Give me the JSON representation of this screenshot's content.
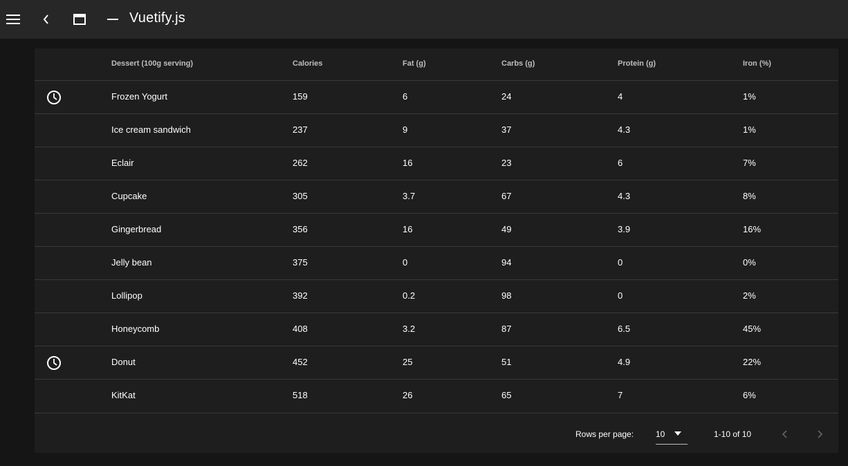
{
  "toolbar": {
    "title": "Vuetify.js",
    "icons": [
      "menu-icon",
      "back-icon",
      "window-icon",
      "minimize-icon"
    ]
  },
  "table": {
    "headers": [
      "Dessert (100g serving)",
      "Calories",
      "Fat (g)",
      "Carbs (g)",
      "Protein (g)",
      "Iron (%)"
    ],
    "rows": [
      {
        "icon": "clock-icon",
        "cells": [
          "Frozen Yogurt",
          "159",
          "6",
          "24",
          "4",
          "1%"
        ]
      },
      {
        "icon": "",
        "cells": [
          "Ice cream sandwich",
          "237",
          "9",
          "37",
          "4.3",
          "1%"
        ]
      },
      {
        "icon": "",
        "cells": [
          "Eclair",
          "262",
          "16",
          "23",
          "6",
          "7%"
        ]
      },
      {
        "icon": "",
        "cells": [
          "Cupcake",
          "305",
          "3.7",
          "67",
          "4.3",
          "8%"
        ]
      },
      {
        "icon": "",
        "cells": [
          "Gingerbread",
          "356",
          "16",
          "49",
          "3.9",
          "16%"
        ]
      },
      {
        "icon": "",
        "cells": [
          "Jelly bean",
          "375",
          "0",
          "94",
          "0",
          "0%"
        ]
      },
      {
        "icon": "",
        "cells": [
          "Lollipop",
          "392",
          "0.2",
          "98",
          "0",
          "2%"
        ]
      },
      {
        "icon": "",
        "cells": [
          "Honeycomb",
          "408",
          "3.2",
          "87",
          "6.5",
          "45%"
        ]
      },
      {
        "icon": "clock-icon",
        "cells": [
          "Donut",
          "452",
          "25",
          "51",
          "4.9",
          "22%"
        ]
      },
      {
        "icon": "",
        "cells": [
          "KitKat",
          "518",
          "26",
          "65",
          "7",
          "6%"
        ]
      }
    ]
  },
  "footer": {
    "rows_per_page_label": "Rows per page:",
    "rows_per_page_value": "10",
    "range_text": "1-10 of 10"
  },
  "colors": {
    "toolbar_bg": "#272727",
    "page_bg": "#151515",
    "card_bg": "#1e1e1e"
  }
}
